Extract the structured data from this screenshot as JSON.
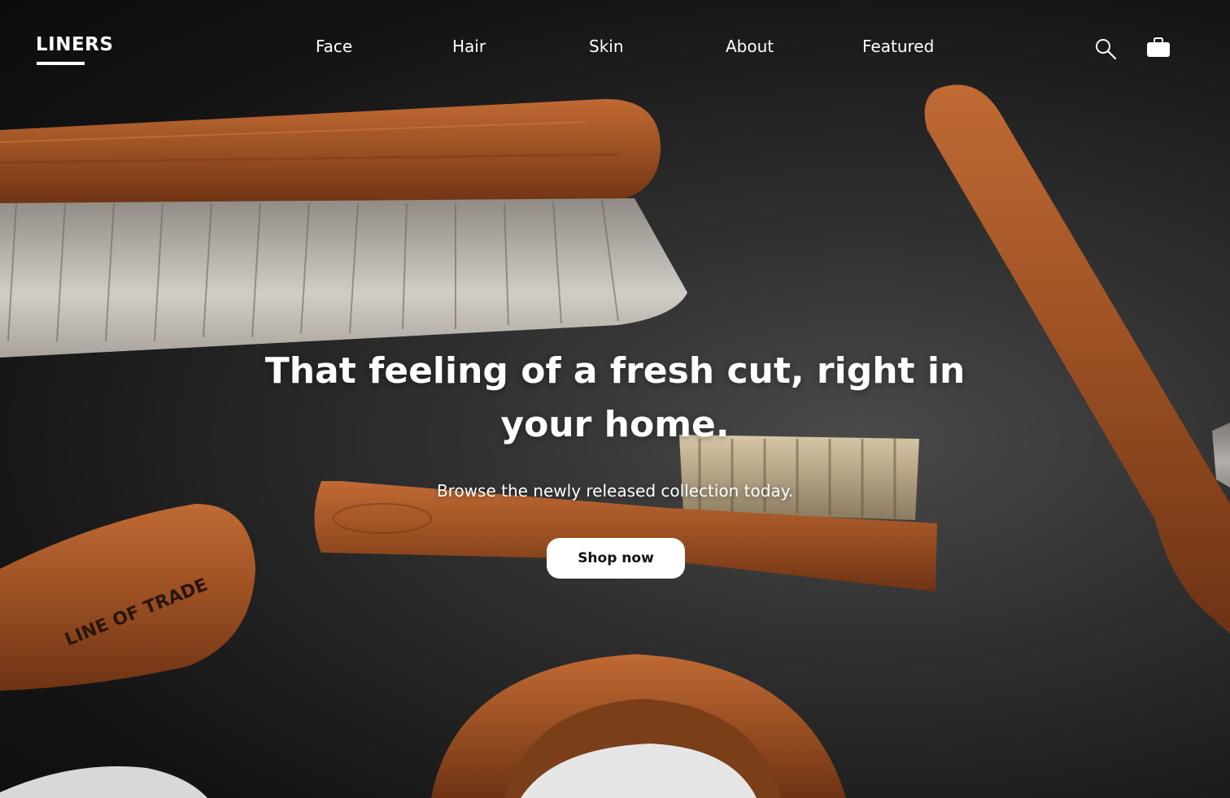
{
  "brand": {
    "logo_text": "LINERS"
  },
  "nav": {
    "links": [
      {
        "label": "Face"
      },
      {
        "label": "Hair"
      },
      {
        "label": "Skin"
      },
      {
        "label": "About"
      },
      {
        "label": "Featured"
      }
    ],
    "icons": [
      "search-icon",
      "briefcase-bag-icon"
    ]
  },
  "hero": {
    "title": "That feeling of a fresh cut, right in your home.",
    "subtitle": "Browse the newly released collection today.",
    "cta_label": "Shop now",
    "background_image": "wooden-grooming-brushes-photo",
    "brush_engraving": "LINE OF TRADE"
  },
  "colors": {
    "text": "#ffffff",
    "button_bg": "#ffffff",
    "button_text": "#111111",
    "wood": "#9a4f22",
    "background": "#1a1a1a"
  }
}
